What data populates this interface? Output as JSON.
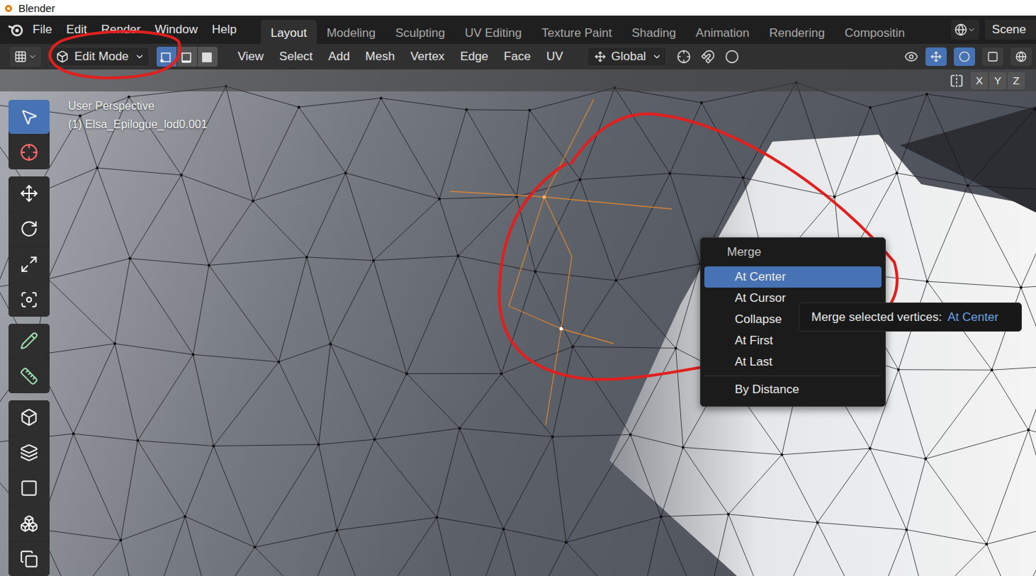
{
  "window": {
    "title": "Blender"
  },
  "menu": [
    "File",
    "Edit",
    "Render",
    "Window",
    "Help"
  ],
  "workspaces": [
    {
      "label": "Layout",
      "selected": true
    },
    {
      "label": "Modeling",
      "selected": false
    },
    {
      "label": "Sculpting",
      "selected": false
    },
    {
      "label": "UV Editing",
      "selected": false
    },
    {
      "label": "Texture Paint",
      "selected": false
    },
    {
      "label": "Shading",
      "selected": false
    },
    {
      "label": "Animation",
      "selected": false
    },
    {
      "label": "Rendering",
      "selected": false
    },
    {
      "label": "Compositin",
      "selected": false
    }
  ],
  "scene": "Scene",
  "header": {
    "mode": "Edit Mode",
    "select_modes": [
      {
        "kind": "vertex",
        "selected": true
      },
      {
        "kind": "edge",
        "selected": false
      },
      {
        "kind": "face",
        "selected": false
      }
    ],
    "menus": [
      "View",
      "Select",
      "Add",
      "Mesh",
      "Vertex",
      "Edge",
      "Face",
      "UV"
    ],
    "orientation": "Global"
  },
  "axes": [
    "X",
    "Y",
    "Z"
  ],
  "tool_groups": [
    [
      {
        "kind": "select",
        "selected": true
      },
      {
        "kind": "cursor",
        "selected": false
      }
    ],
    [
      {
        "kind": "move",
        "selected": false
      },
      {
        "kind": "rotate",
        "selected": false
      },
      {
        "kind": "scale",
        "selected": false
      },
      {
        "kind": "transform",
        "selected": false
      }
    ],
    [
      {
        "kind": "annotate",
        "selected": false
      },
      {
        "kind": "measure",
        "selected": false
      }
    ],
    [
      {
        "kind": "add-cube",
        "selected": false
      },
      {
        "kind": "extrude",
        "selected": false
      },
      {
        "kind": "inset",
        "selected": false
      },
      {
        "kind": "bevel",
        "selected": false
      },
      {
        "kind": "loopcut",
        "selected": false
      }
    ]
  ],
  "viewport": {
    "view": "User Perspective",
    "object": "(1) Elsa_Epilogue_lod0.001"
  },
  "merge_menu": {
    "title": "Merge",
    "sections": [
      [
        {
          "label": "At Center",
          "selected": true
        },
        {
          "label": "At Cursor",
          "selected": false
        },
        {
          "label": "Collapse",
          "selected": false
        },
        {
          "label": "At First",
          "selected": false
        },
        {
          "label": "At Last",
          "selected": false
        }
      ],
      [
        {
          "label": "By Distance",
          "selected": false
        }
      ]
    ]
  },
  "tooltip": {
    "text": "Merge selected vertices:",
    "value": "At Center"
  }
}
